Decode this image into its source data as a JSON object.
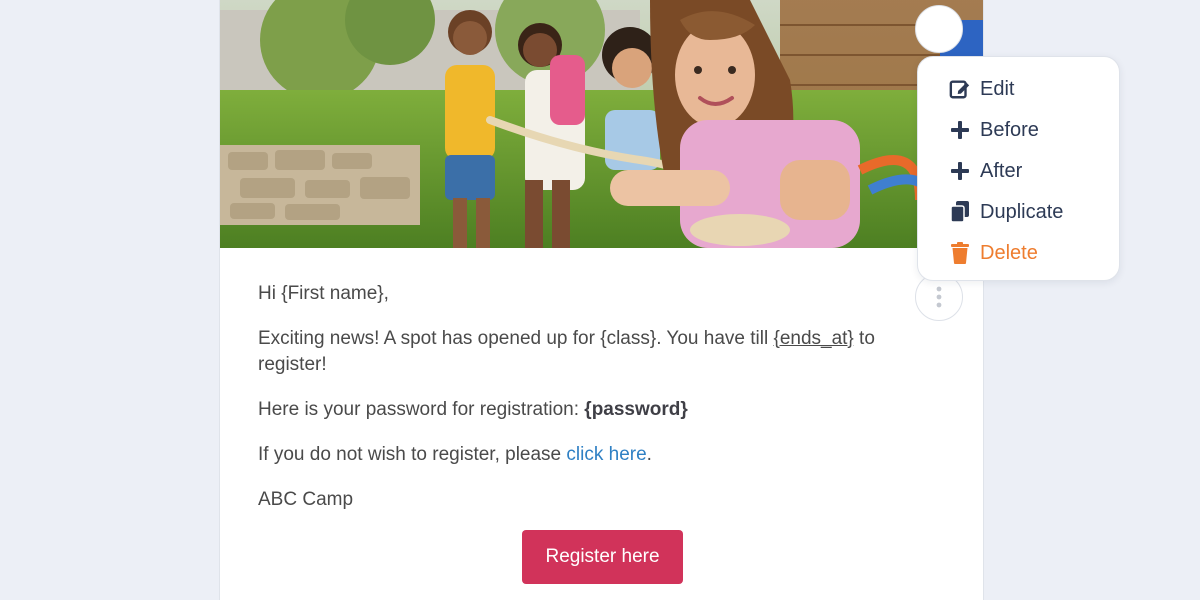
{
  "email": {
    "greeting": "Hi {First name},",
    "line1_before": "Exciting news! A spot has opened up for {class}. You have till ",
    "line1_link": "{ends_at}",
    "line1_after": " to register!",
    "password_prefix": "Here is your password for registration: ",
    "password_token": "{password}",
    "unsubscribe_prefix": "If you do not wish to register, please ",
    "unsubscribe_link": "click here",
    "unsubscribe_suffix": ".",
    "signature": "ABC Camp",
    "cta_label": "Register here"
  },
  "menu": {
    "items": [
      {
        "label": "Edit",
        "icon": "edit-icon"
      },
      {
        "label": "Before",
        "icon": "plus-icon"
      },
      {
        "label": "After",
        "icon": "plus-icon"
      },
      {
        "label": "Duplicate",
        "icon": "copy-icon"
      },
      {
        "label": "Delete",
        "icon": "trash-icon"
      }
    ]
  },
  "colors": {
    "cta": "#d1335a",
    "link": "#2f80c4",
    "danger": "#ee7d2f",
    "menu_text": "#2d3a55",
    "background": "#eceff6"
  }
}
